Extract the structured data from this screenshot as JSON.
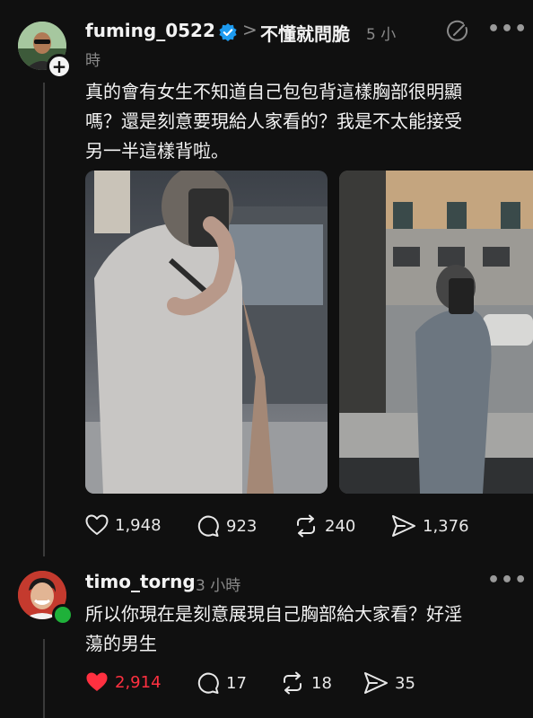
{
  "post": {
    "username": "fuming_0522",
    "topic_separator": ">",
    "topic": "不懂就問脆",
    "time_part1": "5 小",
    "time_part2": "時",
    "text_lines": [
      "真的會有女生不知道自己包包背這樣胸部很明顯",
      "嗎？還是刻意要現給人家看的？我是不太能接受",
      "另一半這樣背啦。"
    ],
    "likes": "1,948",
    "comments": "923",
    "reposts": "240",
    "shares": "1,376"
  },
  "reply": {
    "username": "timo_torng",
    "time": "3 小時",
    "text_lines": [
      "所以你現在是刻意展現自己胸部給大家看？好淫",
      "蕩的男生"
    ],
    "likes": "2,914",
    "comments": "17",
    "reposts": "18",
    "shares": "35"
  },
  "colors": {
    "background": "#101010",
    "verified": "#1d9bf0",
    "liked": "#ff3040",
    "online": "#1fb13a"
  }
}
